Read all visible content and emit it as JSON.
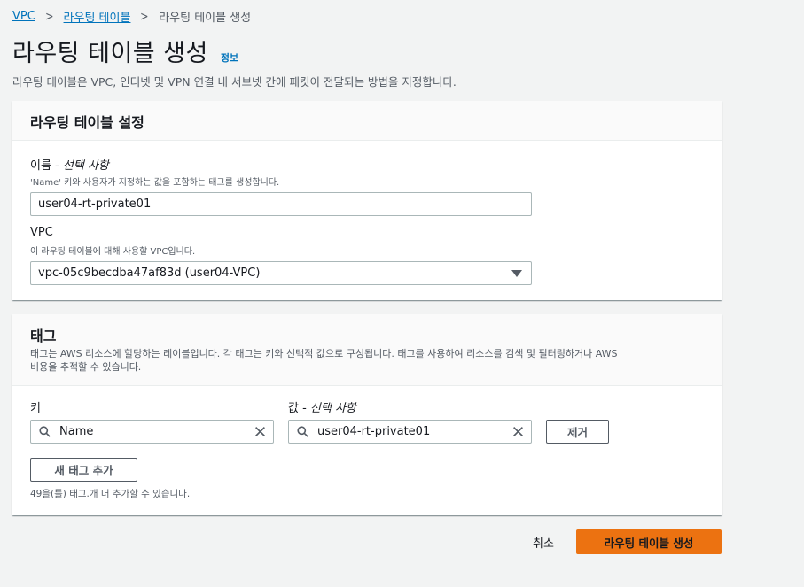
{
  "breadcrumb": {
    "items": [
      "VPC",
      "라우팅 테이블"
    ],
    "current": "라우팅 테이블 생성"
  },
  "header": {
    "title": "라우팅 테이블 생성",
    "info_link": "정보",
    "description": "라우팅 테이블은 VPC, 인터넷 및 VPN 연결 내 서브넷 간에 패킷이 전달되는 방법을 지정합니다."
  },
  "settings": {
    "title": "라우팅 테이블 설정",
    "name_label": "이름 - ",
    "name_optional": "선택 사항",
    "name_hint": "'Name' 키와 사용자가 지정하는 값을 포함하는 태그를 생성합니다.",
    "name_value": "user04-rt-private01",
    "vpc_label": "VPC",
    "vpc_hint": "이 라우팅 테이블에 대해 사용할 VPC입니다.",
    "vpc_value": "vpc-05c9becdba47af83d (user04-VPC)"
  },
  "tags": {
    "title": "태그",
    "description_line1": "태그는 AWS 리소스에 할당하는 레이블입니다. 각 태그는 키와 선택적 값으로 구성됩니다. 태그를 사용하여 리소스를 검색 및 필터링하거나 AWS",
    "description_line2": "비용을 추적할 수 있습니다.",
    "key_label": "키",
    "value_label": "값 - ",
    "value_optional": "선택 사항",
    "rows": [
      {
        "key": "Name",
        "value": "user04-rt-private01",
        "remove_label": "제거"
      }
    ],
    "add_label": "새 태그 추가",
    "remaining_text": "49을(를) 태그.개 더 추가할 수 있습니다."
  },
  "footer": {
    "cancel_label": "취소",
    "submit_label": "라우팅 테이블 생성"
  },
  "colors": {
    "link": "#0073bb",
    "primary": "#ec7211",
    "background": "#f2f3f3",
    "text": "#16191f",
    "muted": "#545b64"
  }
}
